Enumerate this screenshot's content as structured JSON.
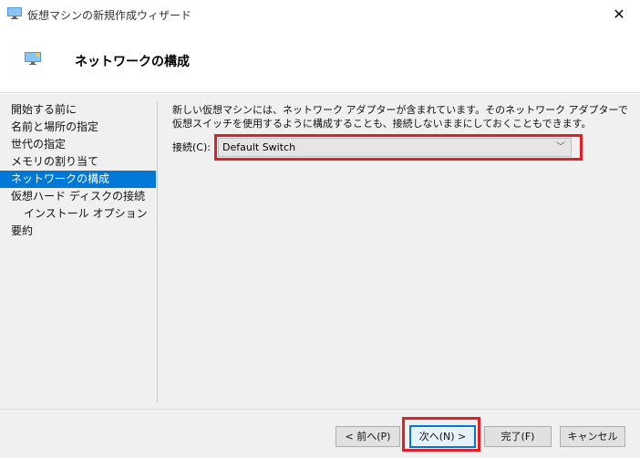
{
  "window": {
    "title": "仮想マシンの新規作成ウィザード",
    "close_glyph": "✕",
    "icon": "monitor-icon"
  },
  "header": {
    "title": "ネットワークの構成",
    "icon": "monitor-icon"
  },
  "sidebar": {
    "items": [
      {
        "label": "開始する前に"
      },
      {
        "label": "名前と場所の指定"
      },
      {
        "label": "世代の指定"
      },
      {
        "label": "メモリの割り当て"
      },
      {
        "label": "ネットワークの構成"
      },
      {
        "label": "仮想ハード ディスクの接続"
      },
      {
        "label": "インストール オプション"
      },
      {
        "label": "要約"
      }
    ],
    "active_index": 4
  },
  "content": {
    "description": "新しい仮想マシンには、ネットワーク アダプターが含まれています。そのネットワーク アダプターで仮想スイッチを使用するように構成することも、接続しないままにしておくこともできます。",
    "connection_label": "接続(C):",
    "connection_value": "Default Switch",
    "connection_chevron": "﹀"
  },
  "footer": {
    "prev_label": "< 前へ(P)",
    "next_label": "次へ(N) >",
    "finish_label": "完了(F)",
    "cancel_label": "キャンセル"
  },
  "colors": {
    "accent": "#0078d7",
    "highlight_red": "#e31e24"
  }
}
